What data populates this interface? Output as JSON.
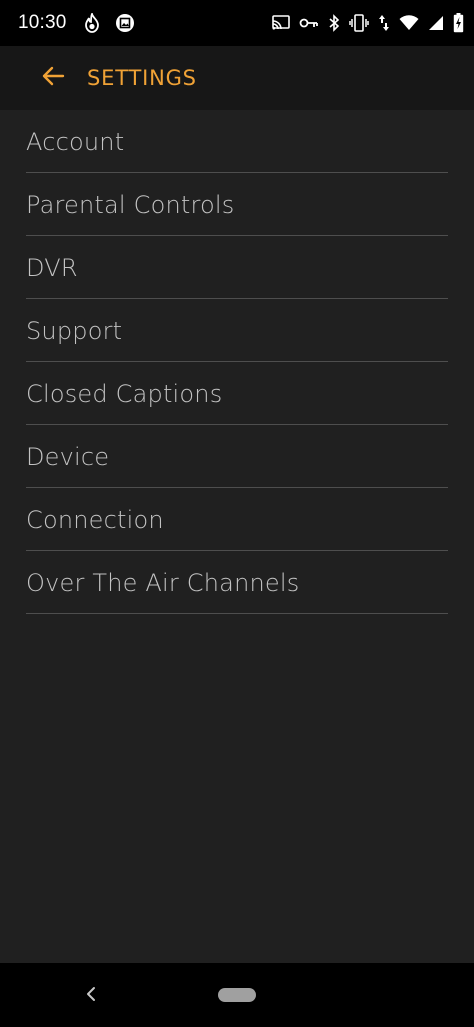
{
  "status_bar": {
    "time": "10:30",
    "left_icons": [
      "flame-icon",
      "photo-frame-icon"
    ],
    "right_icons": [
      "cast-icon",
      "vpn-key-icon",
      "bluetooth-icon",
      "vibrate-icon",
      "data-arrows-icon",
      "wifi-icon",
      "signal-icon",
      "battery-charging-icon"
    ]
  },
  "header": {
    "back_icon": "arrow-left-icon",
    "title": "SETTINGS"
  },
  "menu": {
    "items": [
      {
        "label": "Account"
      },
      {
        "label": "Parental Controls"
      },
      {
        "label": "DVR"
      },
      {
        "label": "Support"
      },
      {
        "label": "Closed Captions"
      },
      {
        "label": "Device"
      },
      {
        "label": "Connection"
      },
      {
        "label": "Over The Air Channels"
      }
    ]
  },
  "nav_bar": {
    "back_icon": "chevron-left-icon",
    "home_icon": "home-pill-icon"
  },
  "colors": {
    "accent": "#f0a236",
    "background": "#202020",
    "header_background": "#171717",
    "text": "#c3c3c3",
    "divider": "#4e4e4e"
  }
}
